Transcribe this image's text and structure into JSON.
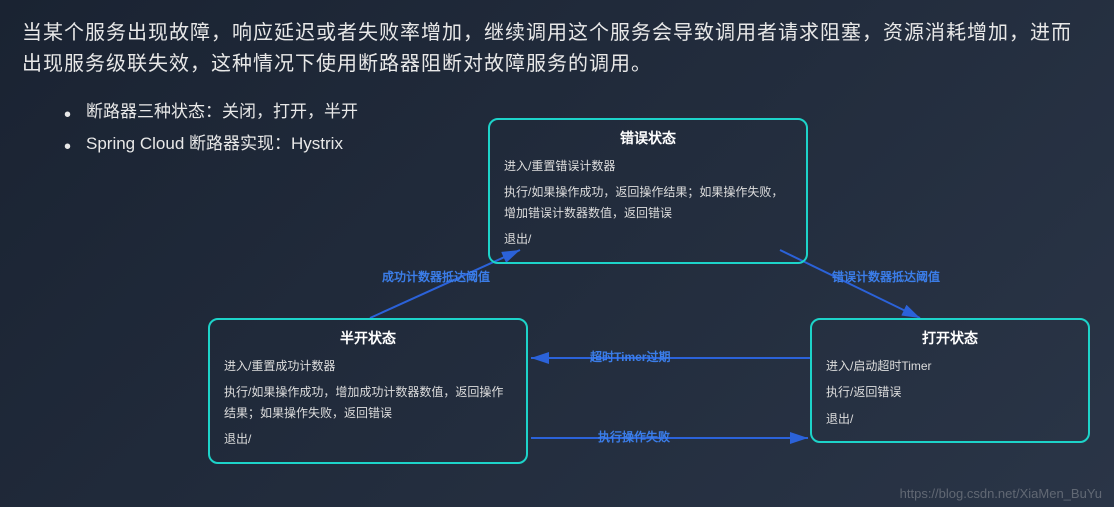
{
  "intro": "当某个服务出现故障，响应延迟或者失败率增加，继续调用这个服务会导致调用者请求阻塞，资源消耗增加，进而出现服务级联失效，这种情况下使用断路器阻断对故障服务的调用。",
  "bullets": [
    "断路器三种状态：关闭，打开，半开",
    "Spring Cloud 断路器实现：Hystrix"
  ],
  "states": {
    "error": {
      "title": "错误状态",
      "enter": "进入/重置错误计数器",
      "exec": "执行/如果操作成功，返回操作结果；如果操作失败，增加错误计数器数值，返回错误",
      "exit": "退出/"
    },
    "half": {
      "title": "半开状态",
      "enter": "进入/重置成功计数器",
      "exec": "执行/如果操作成功，增加成功计数器数值，返回操作结果；如果操作失败，返回错误",
      "exit": "退出/"
    },
    "open": {
      "title": "打开状态",
      "enter": "进入/启动超时Timer",
      "exec": "执行/返回错误",
      "exit": "退出/"
    }
  },
  "edges": {
    "success_threshold": "成功计数器抵达阈值",
    "error_threshold": "错误计数器抵达阈值",
    "timeout": "超时Timer过期",
    "exec_fail": "执行操作失败"
  },
  "watermark": "https://blog.csdn.net/XiaMen_BuYu",
  "colors": {
    "box_border": "#1dd3c9",
    "arrow": "#2b62d9",
    "label": "#3b7de8"
  }
}
